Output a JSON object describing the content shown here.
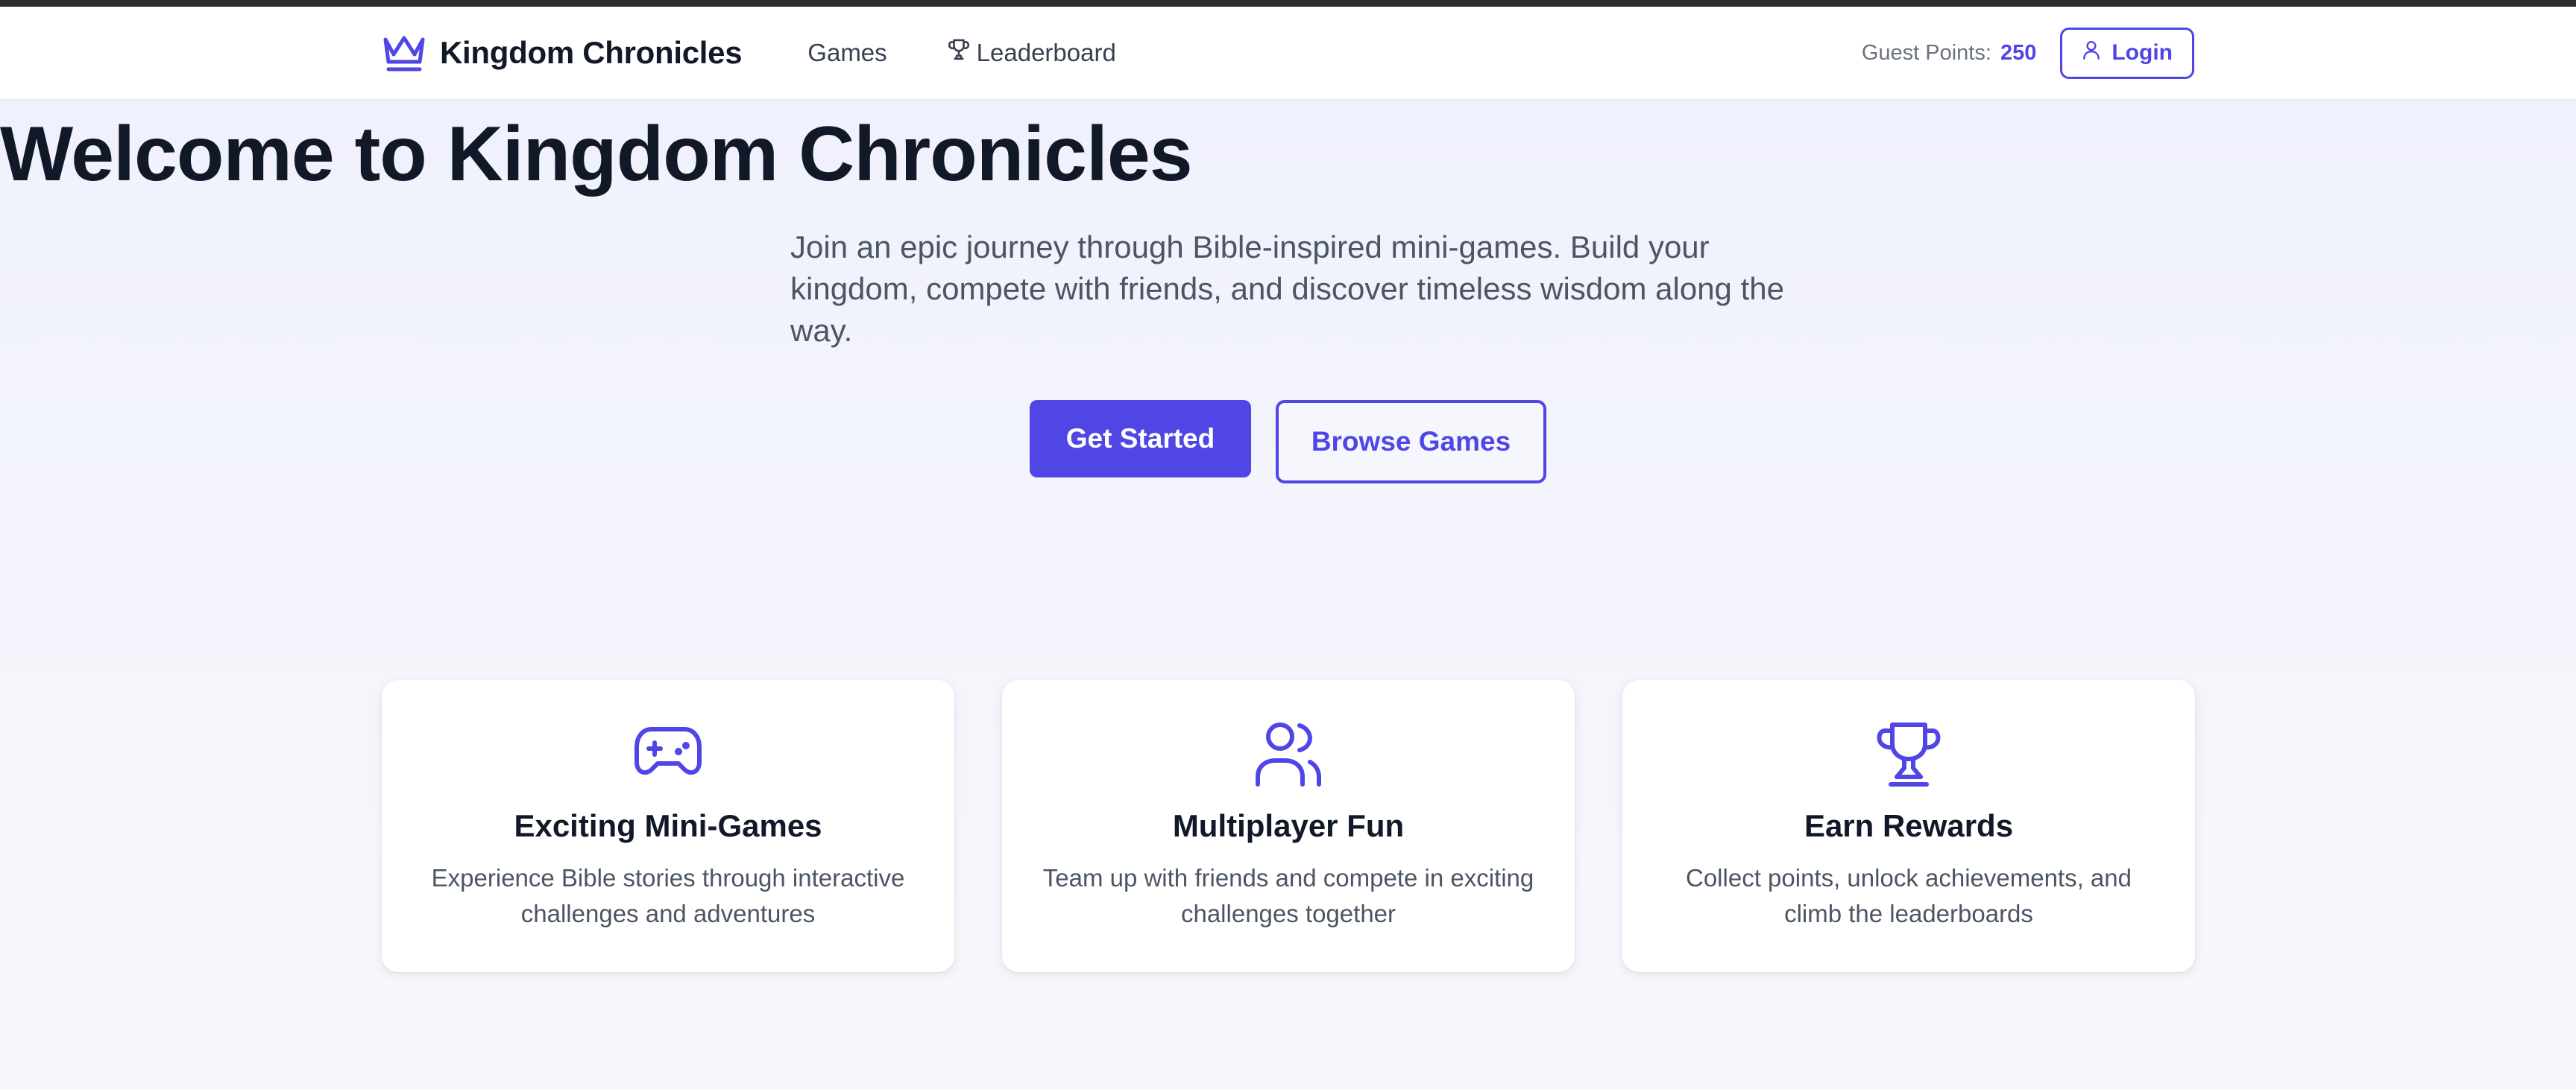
{
  "app": {
    "brand_name": "Kingdom Chronicles",
    "accent_color": "#4f46e5"
  },
  "nav": {
    "links": [
      {
        "label": "Games"
      },
      {
        "label": "Leaderboard",
        "icon": "trophy-icon"
      }
    ],
    "guest_points_label": "Guest Points:",
    "guest_points_value": "250",
    "login_label": "Login"
  },
  "hero": {
    "title": "Welcome to Kingdom Chronicles",
    "subtitle": "Join an epic journey through Bible-inspired mini-games. Build your kingdom, compete with friends, and discover timeless wisdom along the way.",
    "primary_cta": "Get Started",
    "secondary_cta": "Browse Games"
  },
  "features": [
    {
      "icon": "gamepad-icon",
      "title": "Exciting Mini-Games",
      "description": "Experience Bible stories through interactive challenges and adventures"
    },
    {
      "icon": "users-icon",
      "title": "Multiplayer Fun",
      "description": "Team up with friends and compete in exciting challenges together"
    },
    {
      "icon": "trophy-icon",
      "title": "Earn Rewards",
      "description": "Collect points, unlock achievements, and climb the leaderboards"
    }
  ]
}
